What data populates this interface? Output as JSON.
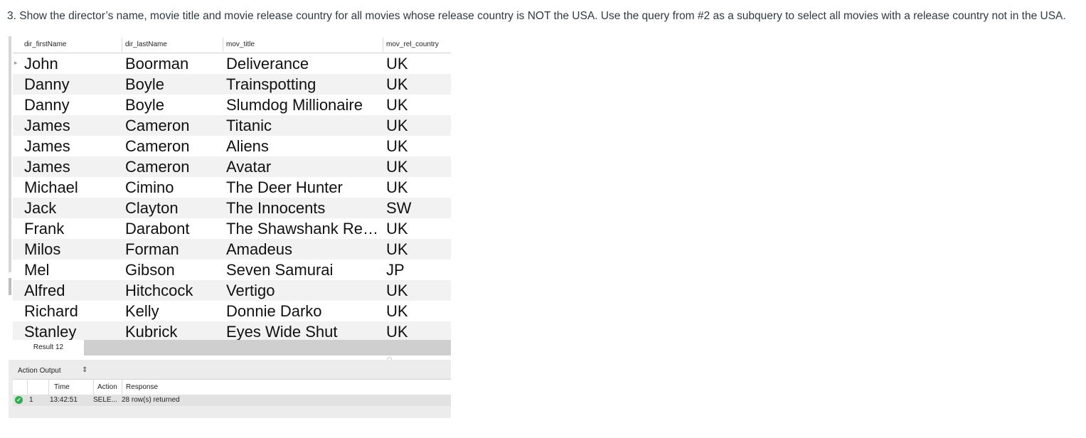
{
  "question": "3. Show the director’s name, movie title and movie release country for all movies whose release country is NOT the USA. Use the query from #2 as a subquery to select all movies with a release country not in the USA.",
  "result_grid": {
    "columns": [
      "dir_firstName",
      "dir_lastName",
      "mov_title",
      "mov_rel_country"
    ],
    "rows": [
      [
        "John",
        "Boorman",
        "Deliverance",
        "UK"
      ],
      [
        "Danny",
        "Boyle",
        "Trainspotting",
        "UK"
      ],
      [
        "Danny",
        "Boyle",
        "Slumdog Millionaire",
        "UK"
      ],
      [
        "James",
        "Cameron",
        "Titanic",
        "UK"
      ],
      [
        "James",
        "Cameron",
        "Aliens",
        "UK"
      ],
      [
        "James",
        "Cameron",
        "Avatar",
        "UK"
      ],
      [
        "Michael",
        "Cimino",
        "The Deer Hunter",
        "UK"
      ],
      [
        "Jack",
        "Clayton",
        "The Innocents",
        "SW"
      ],
      [
        "Frank",
        "Darabont",
        "The Shawshank Re…",
        "UK"
      ],
      [
        "Milos",
        "Forman",
        "Amadeus",
        "UK"
      ],
      [
        "Mel",
        "Gibson",
        "Seven Samurai",
        "JP"
      ],
      [
        "Alfred",
        "Hitchcock",
        "Vertigo",
        "UK"
      ],
      [
        "Richard",
        "Kelly",
        "Donnie Darko",
        "UK"
      ],
      [
        "Stanley",
        "Kubrick",
        "Eyes Wide Shut",
        "UK"
      ]
    ],
    "row_pointer_icon": "triangle-right-icon"
  },
  "result_tab": {
    "label": "Result 12"
  },
  "action_output": {
    "title": "Action Output",
    "selector_icon": "updown-chevron-icon",
    "columns": [
      "",
      "Time",
      "Action",
      "Response"
    ],
    "rows": [
      {
        "status_icon": "check-circle-icon",
        "num": "1",
        "time": "13:42:51",
        "action": "SELE...",
        "response": "28 row(s) returned"
      }
    ]
  },
  "colors": {
    "status_ok": "#2fae4e",
    "zebra": "#f2f2f2"
  }
}
